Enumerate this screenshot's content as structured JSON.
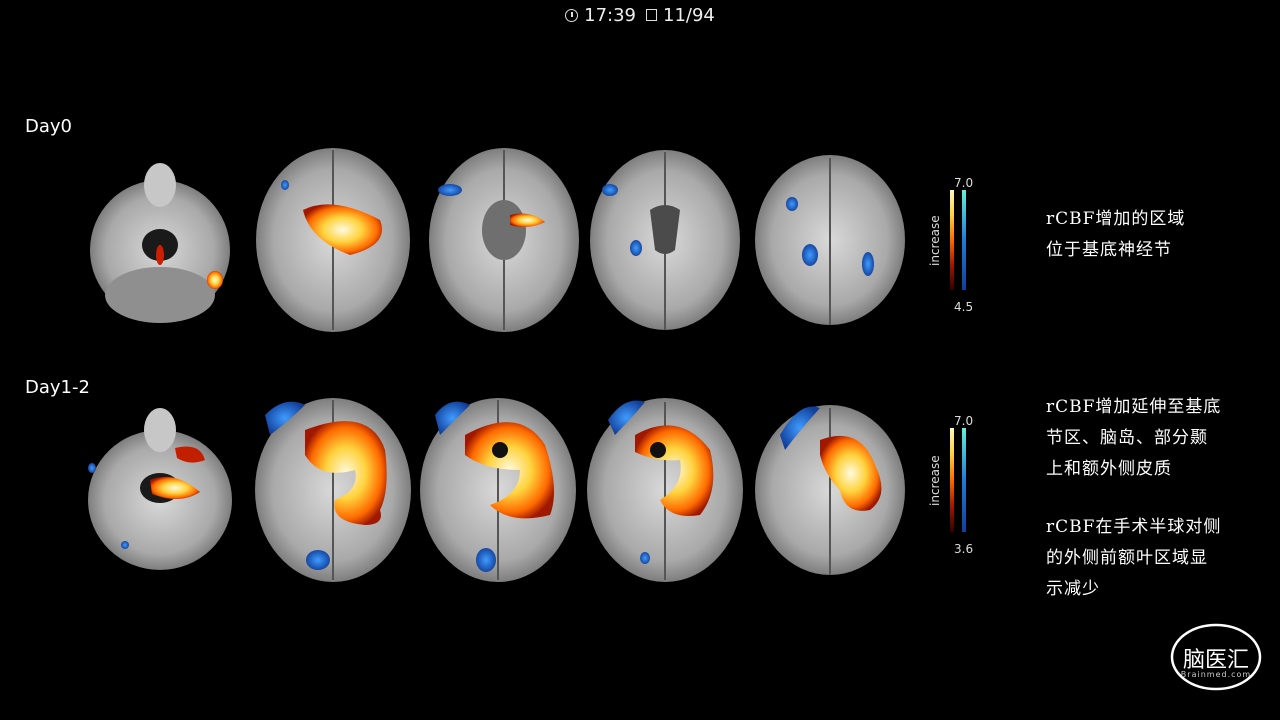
{
  "status": {
    "time": "17:39",
    "page": "11/94"
  },
  "rows": [
    {
      "label": "Day0",
      "colorbar": {
        "title": "increase",
        "max": "7.0",
        "min": "4.5"
      }
    },
    {
      "label": "Day1-2",
      "colorbar": {
        "title": "increase",
        "max": "7.0",
        "min": "3.6"
      }
    }
  ],
  "notes": {
    "n1": [
      "rCBF增加的区域",
      "位于基底神经节"
    ],
    "n2": [
      "rCBF增加延伸至基底",
      "节区、脑岛、部分颞",
      "上和额外侧皮质"
    ],
    "n3": [
      "rCBF在手术半球对侧",
      "的外侧前额叶区域显",
      "示减少"
    ]
  },
  "logo": {
    "text": "脑医汇",
    "sub": "Brainmed.com"
  },
  "colors": {
    "hot": "#ff8a00",
    "cold": "#1f6fd6",
    "brain": "#bdbdbd"
  }
}
